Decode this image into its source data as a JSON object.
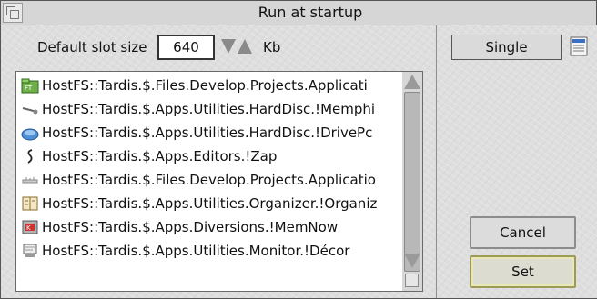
{
  "window": {
    "title": "Run at startup"
  },
  "slot": {
    "label": "Default slot size",
    "value": "640",
    "units": "Kb"
  },
  "list": {
    "items": [
      {
        "icon": "application-folder-icon",
        "path": "HostFS::Tardis.$.Files.Develop.Projects.Applicati"
      },
      {
        "icon": "memphis-icon",
        "path": "HostFS::Tardis.$.Apps.Utilities.HardDisc.!Memphi"
      },
      {
        "icon": "drive-icon",
        "path": "HostFS::Tardis.$.Apps.Utilities.HardDisc.!DrivePc"
      },
      {
        "icon": "zap-icon",
        "path": "HostFS::Tardis.$.Apps.Editors.!Zap"
      },
      {
        "icon": "ruler-icon",
        "path": "HostFS::Tardis.$.Files.Develop.Projects.Applicatio"
      },
      {
        "icon": "organizer-icon",
        "path": "HostFS::Tardis.$.Apps.Utilities.Organizer.!Organiz"
      },
      {
        "icon": "memnow-icon",
        "path": "HostFS::Tardis.$.Apps.Diversions.!MemNow"
      },
      {
        "icon": "decor-icon",
        "path": "HostFS::Tardis.$.Apps.Utilities.Monitor.!Décor"
      }
    ]
  },
  "mode": {
    "value": "Single"
  },
  "buttons": {
    "cancel": "Cancel",
    "set": "Set"
  },
  "colors": {
    "background": "#dcdcdc",
    "accent_set_border": "#9c9c58"
  }
}
